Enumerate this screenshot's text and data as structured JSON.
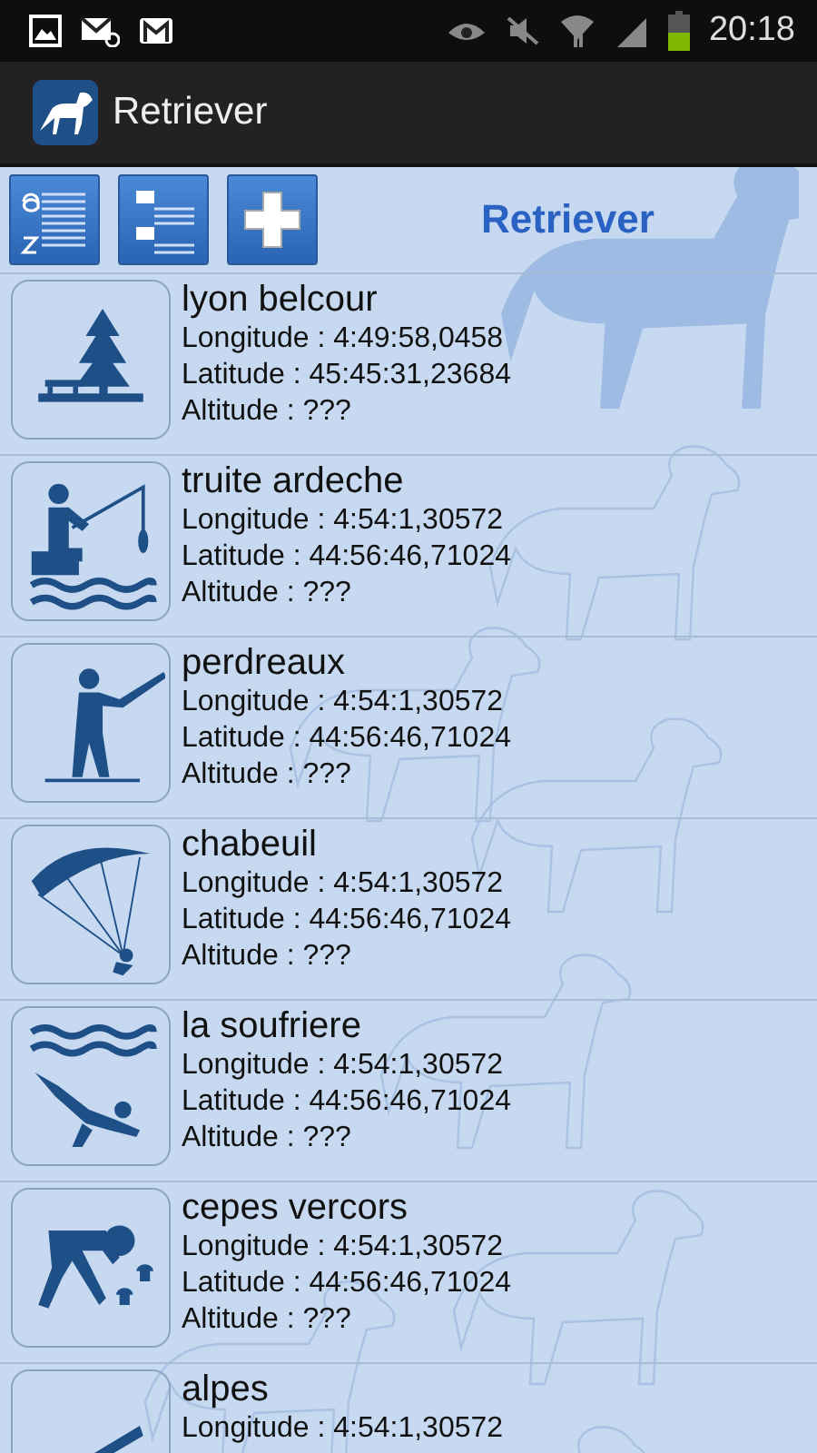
{
  "status_bar": {
    "time": "20:18"
  },
  "action_bar": {
    "title": "Retriever"
  },
  "toolbar": {
    "title": "Retriever"
  },
  "places": [
    {
      "name": "lyon belcour",
      "longitude": "Longitude : 4:49:58,0458",
      "latitude": "Latitude : 45:45:31,23684",
      "altitude": "Altitude : ???"
    },
    {
      "name": "truite ardeche",
      "longitude": "Longitude : 4:54:1,30572",
      "latitude": "Latitude : 44:56:46,71024",
      "altitude": "Altitude : ???"
    },
    {
      "name": "perdreaux",
      "longitude": "Longitude : 4:54:1,30572",
      "latitude": "Latitude : 44:56:46,71024",
      "altitude": "Altitude : ???"
    },
    {
      "name": "chabeuil",
      "longitude": "Longitude : 4:54:1,30572",
      "latitude": "Latitude : 44:56:46,71024",
      "altitude": "Altitude : ???"
    },
    {
      "name": "la soufriere",
      "longitude": "Longitude : 4:54:1,30572",
      "latitude": "Latitude : 44:56:46,71024",
      "altitude": "Altitude : ???"
    },
    {
      "name": "cepes vercors",
      "longitude": "Longitude : 4:54:1,30572",
      "latitude": "Latitude : 44:56:46,71024",
      "altitude": "Altitude : ???"
    },
    {
      "name": "alpes",
      "longitude": "Longitude : 4:54:1,30572"
    }
  ]
}
